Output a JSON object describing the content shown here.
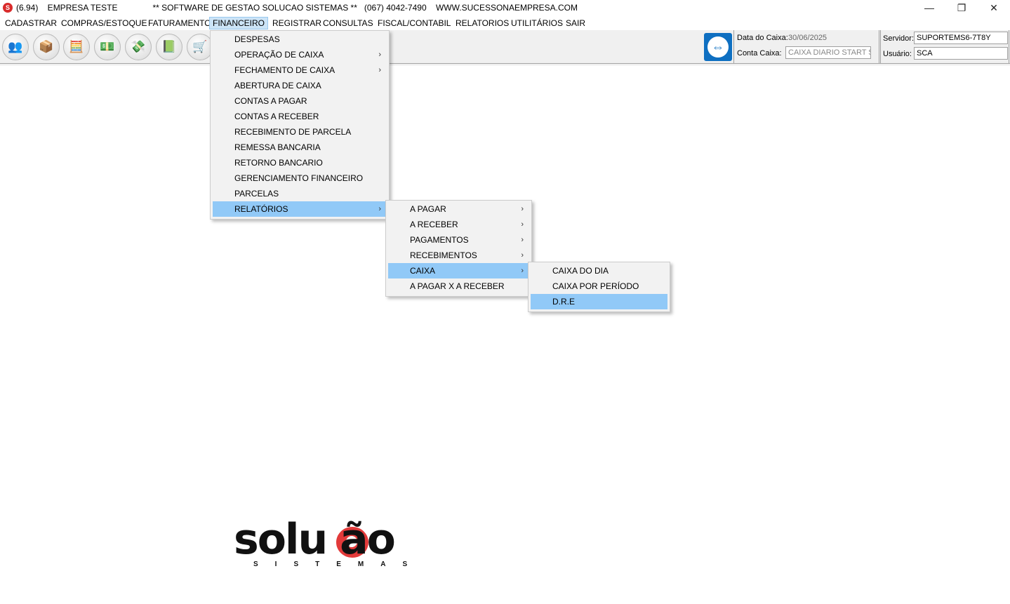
{
  "titlebar": {
    "app_icon_label": "S",
    "title": "(6.94)    EMPRESA TESTE               ** SOFTWARE DE GESTAO SOLUCAO SISTEMAS **   (067) 4042-7490    WWW.SUCESSONAEMPRESA.COM",
    "minimize": "—",
    "restore": "❐",
    "close": "✕"
  },
  "menubar": {
    "items": [
      "CADASTRAR",
      "COMPRAS/ESTOQUE",
      "FATURAMENTO",
      "FINANCEIRO",
      "REGISTRAR",
      "CONSULTAS",
      "FISCAL/CONTABIL",
      "RELATORIOS",
      "UTILITÁRIOS",
      "SAIR"
    ],
    "active": "FINANCEIRO"
  },
  "toolbar": {
    "icons": [
      "users-icon",
      "delivery-icon",
      "calculator-icon",
      "money-icon",
      "money-transfer-icon",
      "cash-book-icon",
      "cart-icon"
    ],
    "glyphs": [
      "👥",
      "📦",
      "🧮",
      "💵",
      "💸",
      "📗",
      "🛒"
    ],
    "remote_glyph": "⇔"
  },
  "info": {
    "data_caixa_label": "Data do Caixa:",
    "data_caixa_value": "30/06/2025",
    "conta_caixa_label": "Conta Caixa:",
    "conta_caixa_value": "CAIXA DIARIO START S",
    "servidor_label": "Servidor:",
    "servidor_value": "SUPORTEMS6-7T8Y",
    "usuario_label": "Usuário:",
    "usuario_value": "SCA"
  },
  "financeiro_menu": {
    "items": [
      "DESPESAS",
      "OPERAÇÃO DE CAIXA",
      "FECHAMENTO DE CAIXA",
      "ABERTURA DE CAIXA",
      "CONTAS A PAGAR",
      "CONTAS  A RECEBER",
      "RECEBIMENTO DE PARCELA",
      "REMESSA BANCARIA",
      "RETORNO BANCARIO",
      "GERENCIAMENTO FINANCEIRO",
      "PARCELAS",
      "RELATÓRIOS"
    ],
    "highlighted": "RELATÓRIOS"
  },
  "relatorios_menu": {
    "items": [
      "A PAGAR",
      "A RECEBER",
      "PAGAMENTOS",
      "RECEBIMENTOS",
      "CAIXA",
      "A PAGAR X A RECEBER"
    ],
    "highlighted": "CAIXA"
  },
  "caixa_menu": {
    "items": [
      "CAIXA DO DIA",
      "CAIXA POR PERÍODO",
      "D.R.E"
    ],
    "highlighted": "D.R.E"
  },
  "submenu_arrow": "›",
  "logo": {
    "word": "solu  ão",
    "sub": "SISTEMAS"
  }
}
